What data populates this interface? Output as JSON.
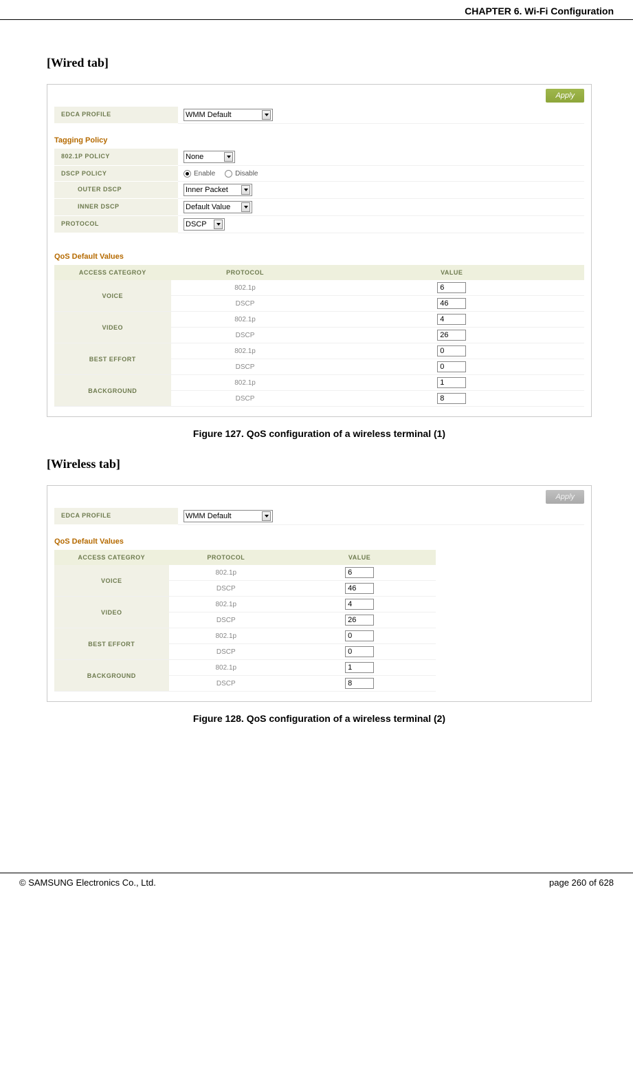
{
  "header": {
    "chapter": "CHAPTER 6. Wi-Fi Configuration"
  },
  "wired": {
    "heading": "[Wired tab]",
    "apply_label": "Apply",
    "fields": {
      "edca_profile_label": "EDCA PROFILE",
      "edca_profile_value": "WMM Default"
    },
    "tagging_title": "Tagging Policy",
    "tagging": {
      "p8021_label": "802.1P POLICY",
      "p8021_value": "None",
      "dscp_policy_label": "DSCP POLICY",
      "enable_label": "Enable",
      "disable_label": "Disable",
      "outer_dscp_label": "OUTER DSCP",
      "outer_dscp_value": "Inner Packet",
      "inner_dscp_label": "INNER DSCP",
      "inner_dscp_value": "Default Value",
      "protocol_label": "PROTOCOL",
      "protocol_value": "DSCP"
    },
    "qos_title": "QoS Default Values",
    "qos_headers": {
      "ac": "ACCESS CATEGROY",
      "proto": "PROTOCOL",
      "val": "VALUE"
    },
    "qos_rows": [
      {
        "cat": "VOICE",
        "p8021": "802.1p",
        "p8021_val": "6",
        "dscp": "DSCP",
        "dscp_val": "46"
      },
      {
        "cat": "VIDEO",
        "p8021": "802.1p",
        "p8021_val": "4",
        "dscp": "DSCP",
        "dscp_val": "26"
      },
      {
        "cat": "BEST EFFORT",
        "p8021": "802.1p",
        "p8021_val": "0",
        "dscp": "DSCP",
        "dscp_val": "0"
      },
      {
        "cat": "BACKGROUND",
        "p8021": "802.1p",
        "p8021_val": "1",
        "dscp": "DSCP",
        "dscp_val": "8"
      }
    ],
    "caption": "Figure 127. QoS configuration of a wireless terminal (1)"
  },
  "wireless": {
    "heading": "[Wireless tab]",
    "apply_label": "Apply",
    "fields": {
      "edca_profile_label": "EDCA PROFILE",
      "edca_profile_value": "WMM Default"
    },
    "qos_title": "QoS Default Values",
    "qos_headers": {
      "ac": "ACCESS CATEGROY",
      "proto": "PROTOCOL",
      "val": "VALUE"
    },
    "qos_rows": [
      {
        "cat": "VOICE",
        "p8021": "802.1p",
        "p8021_val": "6",
        "dscp": "DSCP",
        "dscp_val": "46"
      },
      {
        "cat": "VIDEO",
        "p8021": "802.1p",
        "p8021_val": "4",
        "dscp": "DSCP",
        "dscp_val": "26"
      },
      {
        "cat": "BEST EFFORT",
        "p8021": "802.1p",
        "p8021_val": "0",
        "dscp": "DSCP",
        "dscp_val": "0"
      },
      {
        "cat": "BACKGROUND",
        "p8021": "802.1p",
        "p8021_val": "1",
        "dscp": "DSCP",
        "dscp_val": "8"
      }
    ],
    "caption": "Figure 128. QoS configuration of a wireless terminal (2)"
  },
  "footer": {
    "copyright": "© SAMSUNG Electronics Co., Ltd.",
    "page": "page 260 of 628"
  }
}
